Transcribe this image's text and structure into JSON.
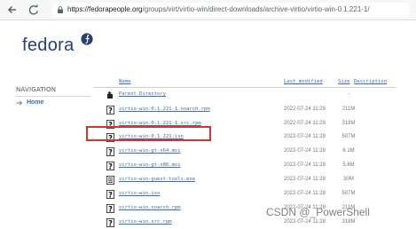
{
  "browser": {
    "back_icon": "back-arrow-icon",
    "reload_icon": "reload-icon",
    "url_host": "https://fedorapeople.org",
    "url_path": "/groups/virt/virtio-win/direct-downloads/archive-virtio/virtio-win-0.1.221-1/"
  },
  "site": {
    "logo_text": "fedora",
    "brand_color": "#294172",
    "link_color": "#3c6eb4"
  },
  "sidebar": {
    "heading": "NAVIGATION",
    "items": [
      {
        "label": "Home"
      }
    ]
  },
  "listing": {
    "columns": {
      "name": "Name",
      "last_modified": "Last modified",
      "size": "Size",
      "description": "Description"
    },
    "rows": [
      {
        "name": "Parent Directory",
        "date": "",
        "size": "-",
        "icon": "back-folder-icon"
      },
      {
        "name": "virtio-win-0.1.221-1.noarch.rpm",
        "date": "2022-07-24 11:28",
        "size": "211M",
        "icon": "unknown-file-icon"
      },
      {
        "name": "virtio-win-0.1.221-1.src.rpm",
        "date": "2022-07-24 11:28",
        "size": "318M",
        "icon": "unknown-file-icon"
      },
      {
        "name": "virtio-win-0.1.221.iso",
        "date": "2022-07-24 11:28",
        "size": "507M",
        "icon": "unknown-file-icon"
      },
      {
        "name": "virtio-win-gt-x64.msi",
        "date": "2022-07-24 11:28",
        "size": "6.1M",
        "icon": "unknown-file-icon"
      },
      {
        "name": "virtio-win-gt-x86.msi",
        "date": "2022-07-24 11:28",
        "size": "5.6M",
        "icon": "unknown-file-icon"
      },
      {
        "name": "virtio-win-guest-tools.exe",
        "date": "2022-07-24 11:28",
        "size": "30M",
        "icon": "binary-file-icon"
      },
      {
        "name": "virtio-win.iso",
        "date": "2022-07-24 11:28",
        "size": "507M",
        "icon": "unknown-file-icon"
      },
      {
        "name": "virtio-win.noarch.rpm",
        "date": "2022-07-24 11:28",
        "size": "211M",
        "icon": "unknown-file-icon"
      },
      {
        "name": "virtio-win.src.rpm",
        "date": "2022-07-24 11:28",
        "size": "318M",
        "icon": "unknown-file-icon"
      }
    ]
  },
  "annotation": {
    "highlight_color": "#e0302a"
  },
  "watermark": "CSDN @_PowerShell"
}
